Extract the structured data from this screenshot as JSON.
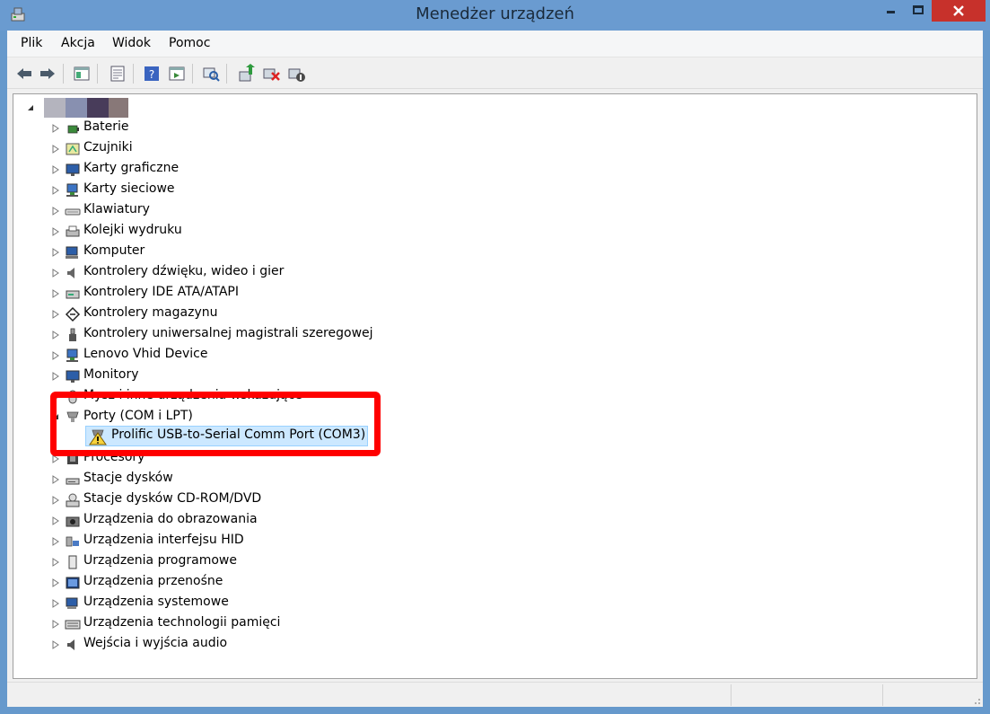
{
  "window": {
    "title": "Menedżer urządzeń"
  },
  "menu": [
    "Plik",
    "Akcja",
    "Widok",
    "Pomoc"
  ],
  "toolbar_buttons": [
    "back-icon",
    "forward-icon",
    "console-tree-icon",
    "properties-icon",
    "help-icon",
    "show-hidden-icon",
    "scan-hardware-icon",
    "update-driver-icon",
    "uninstall-icon",
    "disable-icon"
  ],
  "tree": {
    "root_label": "",
    "root_colors": [
      "#b4b4be",
      "#8890b0",
      "#483c5a",
      "#887878"
    ],
    "items": [
      "Baterie",
      "Czujniki",
      "Karty graficzne",
      "Karty sieciowe",
      "Klawiatury",
      "Kolejki wydruku",
      "Komputer",
      "Kontrolery dźwięku, wideo i gier",
      "Kontrolery IDE ATA/ATAPI",
      "Kontrolery magazynu",
      "Kontrolery uniwersalnej magistrali szeregowej",
      "Lenovo Vhid Device",
      "Monitory",
      "Mysz i inne urządzenia wskazujące",
      "Porty (COM i LPT)",
      "Procesory",
      "Stacje dysków",
      "Stacje dysków CD-ROM/DVD",
      "Urządzenia do obrazowania",
      "Urządzenia interfejsu HID",
      "Urządzenia programowe",
      "Urządzenia przenośne",
      "Urządzenia systemowe",
      "Urządzenia technologii pamięci",
      "Wejścia i wyjścia audio"
    ],
    "expanded_item": "Porty (COM i LPT)",
    "selected_child": "Prolific USB-to-Serial Comm Port (COM3)",
    "selected_child_status": "warning-icon"
  },
  "highlight_color": "#ff0000"
}
